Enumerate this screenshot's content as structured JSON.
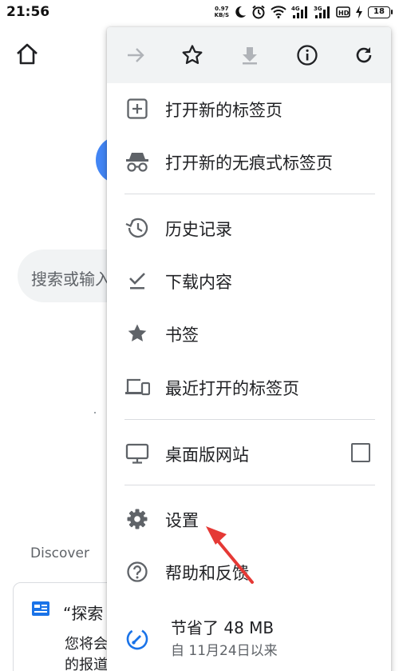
{
  "status_bar": {
    "time": "21:56",
    "speed_value": "0.97",
    "speed_unit": "KB/S",
    "battery": "18",
    "icons": [
      "do-not-disturb-icon",
      "alarm-icon",
      "wifi-icon",
      "signal-4g-icon",
      "signal-3g-icon",
      "hd-icon",
      "charging-icon",
      "battery-icon"
    ]
  },
  "background": {
    "search_placeholder": "搜索或输入",
    "discover_label": "Discover",
    "card_title": "“探索",
    "card_body_line1": "您将会",
    "card_body_line2": "的报道"
  },
  "menu": {
    "toolbar": [
      "forward-icon",
      "bookmark-star-icon",
      "download-icon",
      "info-icon",
      "refresh-icon"
    ],
    "items": {
      "new_tab": "打开新的标签页",
      "new_incognito_tab": "打开新的无痕式标签页",
      "history": "历史记录",
      "downloads": "下载内容",
      "bookmarks": "书签",
      "recent_tabs": "最近打开的标签页",
      "desktop_site": "桌面版网站",
      "settings": "设置",
      "help_feedback": "帮助和反馈"
    },
    "desktop_site_checked": false,
    "data_saver": {
      "title": "节省了 48 MB",
      "subtitle": "自 11月24日以来"
    }
  },
  "colors": {
    "icon_gray": "#5f6368",
    "toolbar_bg": "#f1f3f4",
    "accent_blue": "#1a73e8",
    "annotation_red": "#e53935"
  }
}
